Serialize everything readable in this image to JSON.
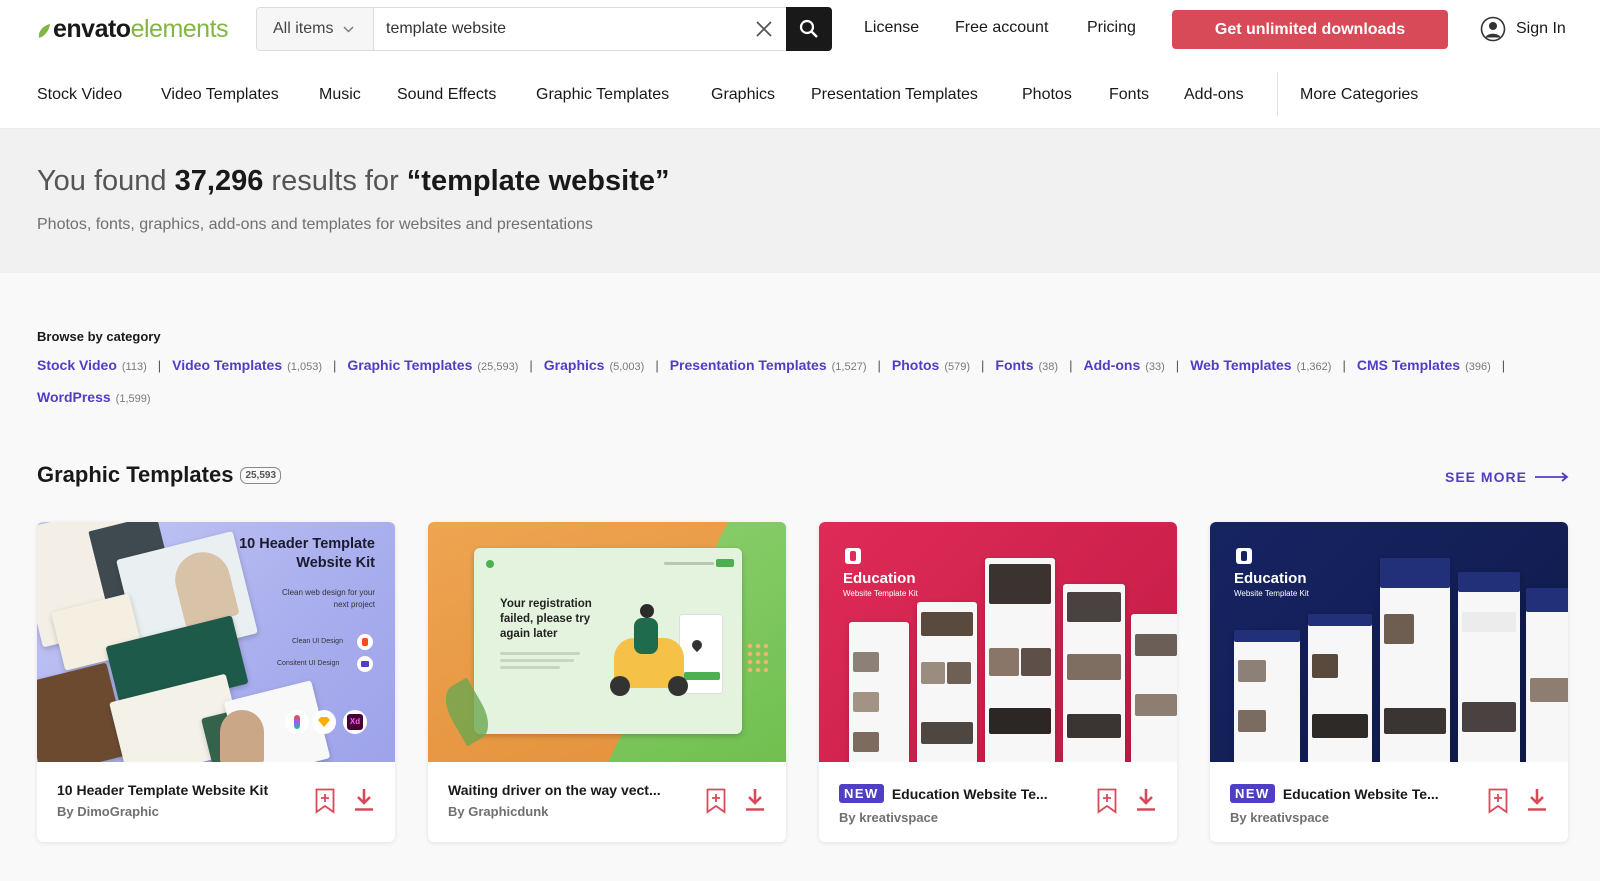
{
  "header": {
    "logo_part1": "envato",
    "logo_part2": "elements",
    "scope_label": "All items",
    "search_value": "template website",
    "nav_license": "License",
    "nav_free_account": "Free account",
    "nav_pricing": "Pricing",
    "cta_label": "Get unlimited downloads",
    "signin_label": "Sign In"
  },
  "categories": [
    "Stock Video",
    "Video Templates",
    "Music",
    "Sound Effects",
    "Graphic Templates",
    "Graphics",
    "Presentation Templates",
    "Photos",
    "Fonts",
    "Add-ons",
    "More Categories"
  ],
  "hero": {
    "prefix": "You found",
    "count": "37,296",
    "middle": "results for",
    "query": "“template website”",
    "subtitle": "Photos, fonts, graphics, add-ons and templates for websites and presentations"
  },
  "browse": {
    "title": "Browse by category",
    "links": [
      {
        "label": "Stock Video",
        "count": "(113)"
      },
      {
        "label": "Video Templates",
        "count": "(1,053)"
      },
      {
        "label": "Graphic Templates",
        "count": "(25,593)"
      },
      {
        "label": "Graphics",
        "count": "(5,003)"
      },
      {
        "label": "Presentation Templates",
        "count": "(1,527)"
      },
      {
        "label": "Photos",
        "count": "(579)"
      },
      {
        "label": "Fonts",
        "count": "(38)"
      },
      {
        "label": "Add-ons",
        "count": "(33)"
      },
      {
        "label": "Web Templates",
        "count": "(1,362)"
      },
      {
        "label": "CMS Templates",
        "count": "(396)"
      },
      {
        "label": "WordPress",
        "count": "(1,599)"
      }
    ]
  },
  "section": {
    "title": "Graphic Templates",
    "count": "25,593",
    "see_more": "SEE MORE"
  },
  "cards": [
    {
      "title": "10 Header Template Website Kit",
      "author": "By DimoGraphic",
      "thumb": {
        "heading": "10 Header Template",
        "heading2": "Website Kit",
        "tagline": "Clean web design for your",
        "tagline2": "next project",
        "feature1": "Clean UI Design",
        "feature2": "Consitent UI Design",
        "badge_xd": "Xd"
      }
    },
    {
      "title": "Waiting driver on the way vect...",
      "author": "By Graphicdunk",
      "thumb": {
        "message": "Your registration",
        "message2": "failed, please try",
        "message3": "again later"
      }
    },
    {
      "badge": "NEW",
      "title": "Education Website Te...",
      "author": "By kreativspace",
      "thumb": {
        "heading": "Education",
        "sub": "Website Template Kit"
      }
    },
    {
      "badge": "NEW",
      "title": "Education Website Te...",
      "author": "By kreativspace",
      "thumb": {
        "heading": "Education",
        "sub": "Website Template Kit"
      }
    }
  ],
  "colors": {
    "brand_green": "#82b541",
    "cta_red": "#d94a58",
    "link_purple": "#4f3fc4",
    "card1_bg": "#b4b8f0",
    "card2_bg": "#e99a44",
    "card3_bg": "#d4224f",
    "card4_bg": "#14215a"
  }
}
